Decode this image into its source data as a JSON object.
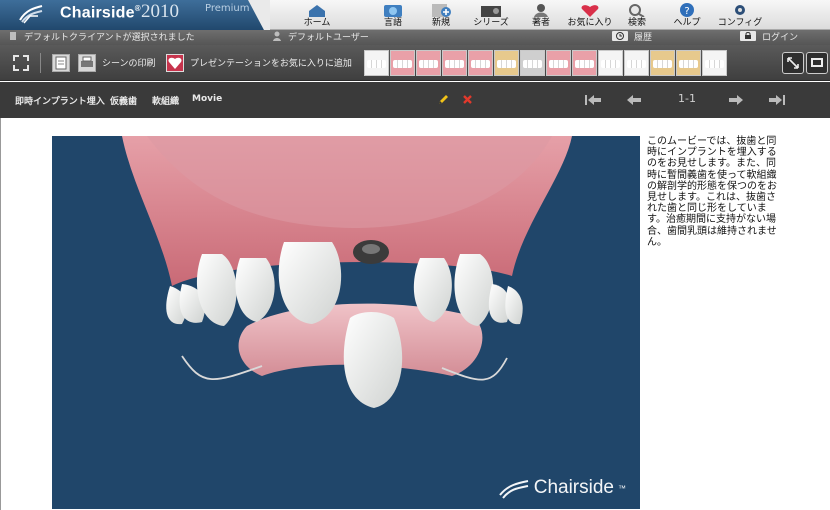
{
  "brand": {
    "name": "Chairside",
    "trademark": "®",
    "year": "2010",
    "edition": "Premium"
  },
  "nav": [
    {
      "id": "home",
      "label": "ホーム",
      "icon": "home-icon"
    },
    {
      "id": "language",
      "label": "言語",
      "icon": "language-icon"
    },
    {
      "id": "new",
      "label": "新規",
      "icon": "new-icon"
    },
    {
      "id": "series",
      "label": "シリーズ",
      "icon": "series-icon"
    },
    {
      "id": "author",
      "label": "著者",
      "icon": "author-icon"
    },
    {
      "id": "favorites",
      "label": "お気に入り",
      "icon": "favorites-icon"
    },
    {
      "id": "search",
      "label": "検索",
      "icon": "search-icon"
    },
    {
      "id": "help",
      "label": "ヘルプ",
      "icon": "help-icon"
    },
    {
      "id": "config",
      "label": "コンフィグ",
      "icon": "gear-icon"
    }
  ],
  "status": {
    "client": "デフォルトクライアントが選択されました",
    "user": "デフォルトユーザー",
    "history": "履歴",
    "login": "ログイン"
  },
  "toolbar": {
    "print_scene": "シーンの印刷",
    "add_favorite": "プレゼンテーションをお気に入りに追加"
  },
  "title": {
    "crumbs": [
      "即時インプラント埋入",
      "仮義歯",
      "軟組織",
      "Movie"
    ],
    "page_indicator": "1-1"
  },
  "viewer": {
    "watermark": "Chairside",
    "watermark_tm": "™"
  },
  "description": "このムービーでは、抜歯と同時にインプラントを埋入するのをお見せします。また、同時に暫間義歯を使って軟組織の解剖学的形態を保つのをお見せします。これは、抜歯された歯と同じ形をしています。治癒期間に支持がない場合、歯間乳頭は維持されません。",
  "colors": {
    "viewer_bg": "#20466a",
    "brand_bg": "#2f5c86",
    "gum": "#d8848d"
  }
}
